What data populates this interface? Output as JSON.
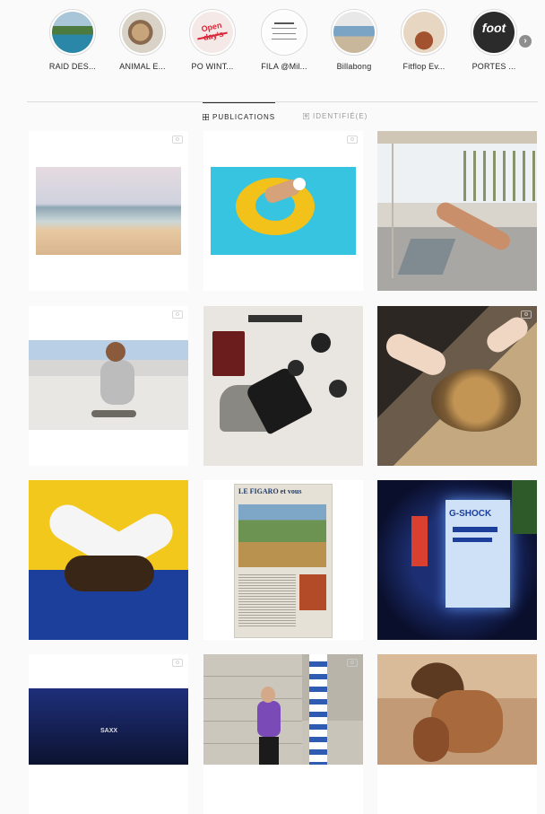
{
  "highlights": [
    {
      "label": "RAID DES...",
      "icon": "coastal-landscape"
    },
    {
      "label": "ANIMAL E...",
      "icon": "animal-photo"
    },
    {
      "label": "PO WINT...",
      "icon": "open-days-sign",
      "text": "Open day's"
    },
    {
      "label": "FILA @Mil...",
      "icon": "document-thumb"
    },
    {
      "label": "Billabong",
      "icon": "shop-photo"
    },
    {
      "label": "Fitflop Ev...",
      "icon": "event-photo"
    },
    {
      "label": "PORTES ...",
      "icon": "foot-logo",
      "text": "foot"
    }
  ],
  "next_icon": "chevron-right-icon",
  "next_glyph": "›",
  "tabs": [
    {
      "label": "PUBLICATIONS",
      "icon": "grid-icon",
      "active": true
    },
    {
      "label": "IDENTIFIÉ(E)",
      "icon": "tagged-icon",
      "active": false
    }
  ],
  "posts": [
    {
      "kind": "beach",
      "video": true
    },
    {
      "kind": "pool-float",
      "video": true
    },
    {
      "kind": "terrace-sunbather",
      "video": false
    },
    {
      "kind": "child-on-deck",
      "video": true
    },
    {
      "kind": "travel-flatlay",
      "video": false
    },
    {
      "kind": "hands-bowl",
      "video": true
    },
    {
      "kind": "sneakers-yellow",
      "video": false
    },
    {
      "kind": "newspaper",
      "video": false,
      "text": "LE FIGARO et vous"
    },
    {
      "kind": "gshock-display",
      "video": false,
      "text": "G-SHOCK"
    },
    {
      "kind": "dark-stage",
      "video": true,
      "text": "SAXX"
    },
    {
      "kind": "street-woman",
      "video": true
    },
    {
      "kind": "desert-woman",
      "video": false
    }
  ]
}
